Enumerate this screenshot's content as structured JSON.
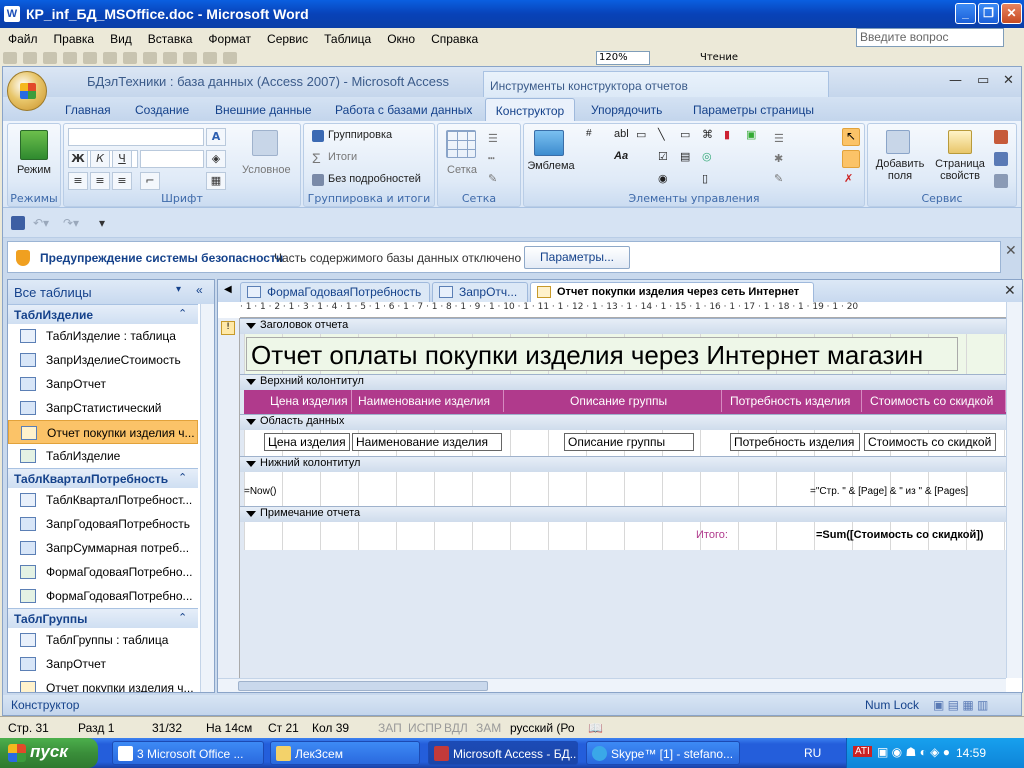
{
  "word": {
    "title": "КР_inf_БД_MSOffice.doc - Microsoft Word",
    "menu": [
      "Файл",
      "Правка",
      "Вид",
      "Вставка",
      "Формат",
      "Сервис",
      "Таблица",
      "Окно",
      "Справка"
    ],
    "help_placeholder": "Введите вопрос",
    "zoom": "120%",
    "toolbar_reading": "Чтение",
    "status": {
      "page": "Стр. 31",
      "section": "Разд 1",
      "pages": "31/32",
      "at": "На 14см",
      "line": "Ст 21",
      "col": "Кол 39",
      "rec": "ЗАП",
      "trk": "ИСПР",
      "ext": "ВДЛ",
      "ovr": "ЗАМ",
      "lang": "русский (Ро"
    }
  },
  "access": {
    "title": "БДэлТехники : база данных (Access 2007) - Microsoft Access",
    "context_tools": "Инструменты конструктора отчетов",
    "tabs": [
      "Главная",
      "Создание",
      "Внешние данные",
      "Работа с базами данных",
      "Конструктор",
      "Упорядочить",
      "Параметры страницы"
    ],
    "active_tab": "Конструктор",
    "ribbon": {
      "modes": {
        "label": "Режимы",
        "view": "Режим"
      },
      "font": {
        "label": "Шрифт",
        "bold": "Ж",
        "italic": "К",
        "underline": "Ч",
        "conditional": "Условное"
      },
      "grouping": {
        "label": "Группировка и итоги",
        "group": "Группировка",
        "totals": "Итоги",
        "hide_details": "Без подробностей"
      },
      "grid": {
        "label": "Сетка",
        "grid_btn": "Сетка"
      },
      "controls": {
        "label": "Элементы управления",
        "logo": "Эмблема"
      },
      "tools": {
        "label": "Сервис",
        "add_fields": "Добавить поля",
        "property_sheet": "Страница свойств"
      }
    },
    "security": {
      "title": "Предупреждение системы безопасности",
      "message": "Часть содержимого базы данных отключено",
      "button": "Параметры..."
    },
    "nav": {
      "header": "Все таблицы",
      "groups": [
        {
          "name": "ТаблИзделие",
          "items": [
            {
              "label": "ТаблИзделие : таблица",
              "kind": "table"
            },
            {
              "label": "ЗапрИзделиеСтоимость",
              "kind": "query"
            },
            {
              "label": "ЗапрОтчет",
              "kind": "query"
            },
            {
              "label": "ЗапрСтатистический",
              "kind": "query"
            },
            {
              "label": "Отчет покупки изделия ч...",
              "kind": "report",
              "selected": true
            },
            {
              "label": "ТаблИзделие",
              "kind": "form"
            }
          ]
        },
        {
          "name": "ТаблКварталПотребность",
          "items": [
            {
              "label": "ТаблКварталПотребност...",
              "kind": "table"
            },
            {
              "label": "ЗапрГодоваяПотребность",
              "kind": "query"
            },
            {
              "label": "ЗапрСуммарная потреб...",
              "kind": "query"
            },
            {
              "label": "ФормаГодоваяПотребно...",
              "kind": "form"
            },
            {
              "label": "ФормаГодоваяПотребно...",
              "kind": "form"
            }
          ]
        },
        {
          "name": "ТаблГруппы",
          "items": [
            {
              "label": "ТаблГруппы : таблица",
              "kind": "table"
            },
            {
              "label": "ЗапрОтчет",
              "kind": "query"
            },
            {
              "label": "Отчет покупки изделия ч...",
              "kind": "report"
            }
          ]
        }
      ]
    },
    "doc_tabs": [
      "ФормаГодоваяПотребность",
      "ЗапрОтч...",
      "Отчет покупки изделия через сеть Интернет"
    ],
    "ruler": "· 1 · 1 · 2 · 1 · 3 · 1 · 4 · 1 · 5 · 1 · 6 · 1 · 7 · 1 · 8 · 1 · 9 · 1 · 10 · 1 · 11 · 1 · 12 · 1 · 13 · 1 · 14 · 1 · 15 · 1 · 16 · 1 · 17 · 1 · 18 · 1 · 19 · 1 · 20",
    "report": {
      "sections": {
        "report_header": "Заголовок отчета",
        "page_header": "Верхний колонтитул",
        "detail": "Область данных",
        "page_footer": "Нижний колонтитул",
        "report_footer": "Примечание отчета"
      },
      "title": "Отчет оплаты покупки изделия через Интернет магазин",
      "header_labels": [
        "Цена изделия",
        "Наименование изделия",
        "Описание группы",
        "Потребность изделия",
        "Стоимость со скидкой"
      ],
      "detail_fields": [
        "Цена изделия",
        "Наименование изделия",
        "Описание группы",
        "Потребность изделия",
        "Стоимость со скидкой"
      ],
      "footer_now": "=Now()",
      "footer_page": "=\"Стр. \" & [Page] & \" из \" & [Pages]",
      "total_label": "Итого:",
      "total_expr": "=Sum([Стоимость со скидкой])"
    },
    "status": {
      "left": "Конструктор",
      "right": "Num Lock"
    }
  },
  "taskbar": {
    "start": "пуск",
    "buttons": [
      "3 Microsoft Office ...",
      "ЛекЗсем",
      "Microsoft Access - БД...",
      "Skype™ [1] - stefano..."
    ],
    "lang": "RU",
    "time": "14:59"
  },
  "colors": {
    "accent": "#b03a8c",
    "selected": "#fbc368",
    "ribbon_text": "#15428b"
  }
}
